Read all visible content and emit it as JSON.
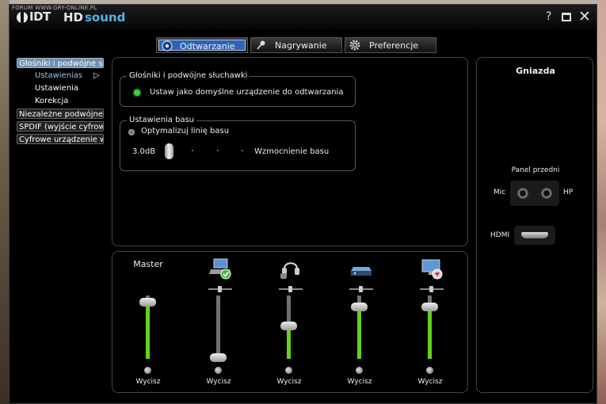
{
  "watermark": "FORUM WWW.GRY-ONLINE.PL",
  "app": {
    "logo_brand": "IDT",
    "logo_hd": "HD",
    "logo_sound": "sound",
    "help_label": "?"
  },
  "tabs": [
    {
      "label": "Odtwarzanie",
      "icon": "speaker-icon",
      "active": true
    },
    {
      "label": "Nagrywanie",
      "icon": "microphone-icon",
      "active": false
    },
    {
      "label": "Preferencje",
      "icon": "gear-icon",
      "active": false
    }
  ],
  "tree": {
    "items": [
      {
        "label": "Głośniki i podwójne słuchawki",
        "selected": true
      },
      {
        "label": "Ustawienias",
        "sub": true,
        "active": true
      },
      {
        "label": "Ustawienia",
        "sub": true
      },
      {
        "label": "Korekcja",
        "sub": true
      },
      {
        "label": "Niezależne podwójne słuchawki"
      },
      {
        "label": "SPDIF (wyjście cyfrowe)"
      },
      {
        "label": "Cyfrowe urządzenie wyjściowe"
      }
    ],
    "arrow": "▷"
  },
  "speaker_group": {
    "title": "Głośniki i podwójne słuchawki",
    "default_label": "Ustaw jako domyślne urządzenie do odtwarzania"
  },
  "bass_group": {
    "title": "Ustawienia basu",
    "optimize_label": "Optymalizuj linię basu",
    "value": "3.0dB",
    "boost_label": "Wzmocnienie basu"
  },
  "mixer": {
    "channels": [
      {
        "title": "Master",
        "icon": null,
        "volume": 0.9,
        "mute_label": "Wycisz"
      },
      {
        "title": "",
        "icon": "laptop-speakers-icon",
        "volume": 0.02,
        "mute_label": "Wycisz"
      },
      {
        "title": "",
        "icon": "headphones-icon",
        "volume": 0.52,
        "mute_label": "Wycisz"
      },
      {
        "title": "",
        "icon": "spdif-device-icon",
        "volume": 0.82,
        "mute_label": "Wycisz"
      },
      {
        "title": "",
        "icon": "monitor-output-icon",
        "volume": 0.82,
        "mute_label": "Wycisz"
      }
    ]
  },
  "jacks": {
    "title": "Gniazda",
    "front_panel": "Panel przedni",
    "mic": "Mic",
    "hp": "HP",
    "hdmi": "HDMI"
  },
  "colors": {
    "accent": "#2d64b5",
    "volume_fill": "#63d11f",
    "sound_text": "#4fb4e8"
  }
}
